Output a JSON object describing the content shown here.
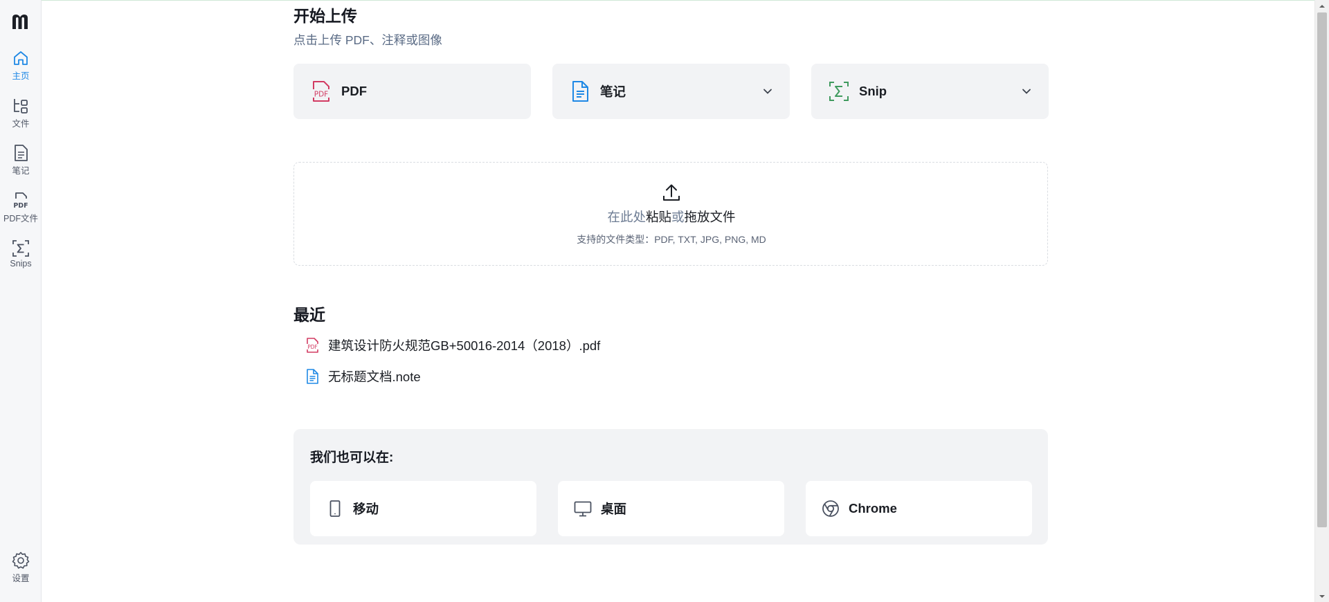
{
  "colors": {
    "accent": "#1e88e5",
    "pdf_red": "#d23b62",
    "note_blue": "#1e88e5",
    "snip_green": "#3f9a5e",
    "sidebar_bg": "#f6f7f9",
    "card_bg": "#f2f3f5"
  },
  "sidebar": {
    "logo_icon": "mathpix-logo",
    "items": [
      {
        "label": "主页",
        "icon": "home-icon"
      },
      {
        "label": "文件",
        "icon": "files-icon"
      },
      {
        "label": "笔记",
        "icon": "note-icon"
      },
      {
        "label": "PDF文件",
        "icon": "pdf-icon"
      },
      {
        "label": "Snips",
        "icon": "sigma-icon"
      }
    ],
    "settings": {
      "label": "设置",
      "icon": "gear-icon"
    }
  },
  "upload": {
    "title": "开始上传",
    "subtitle": "点击上传 PDF、注释或图像",
    "cards": [
      {
        "label": "PDF",
        "icon": "pdf-icon"
      },
      {
        "label": "笔记",
        "icon": "note-icon"
      },
      {
        "label": "Snip",
        "icon": "sigma-icon"
      }
    ]
  },
  "dropzone": {
    "part1": "在此处",
    "part2": "粘贴",
    "part3": "或",
    "part4": "拖放文件",
    "supported": "支持的文件类型：PDF, TXT, JPG, PNG, MD"
  },
  "recent": {
    "title": "最近",
    "items": [
      {
        "name": "建筑设计防火规范GB+50016-2014（2018）.pdf",
        "icon": "pdf-file-icon"
      },
      {
        "name": "无标题文档.note",
        "icon": "note-file-icon"
      }
    ]
  },
  "platforms": {
    "title": "我们也可以在:",
    "items": [
      {
        "label": "移动",
        "icon": "mobile-icon"
      },
      {
        "label": "桌面",
        "icon": "desktop-icon"
      },
      {
        "label": "Chrome",
        "icon": "chrome-icon"
      }
    ]
  }
}
